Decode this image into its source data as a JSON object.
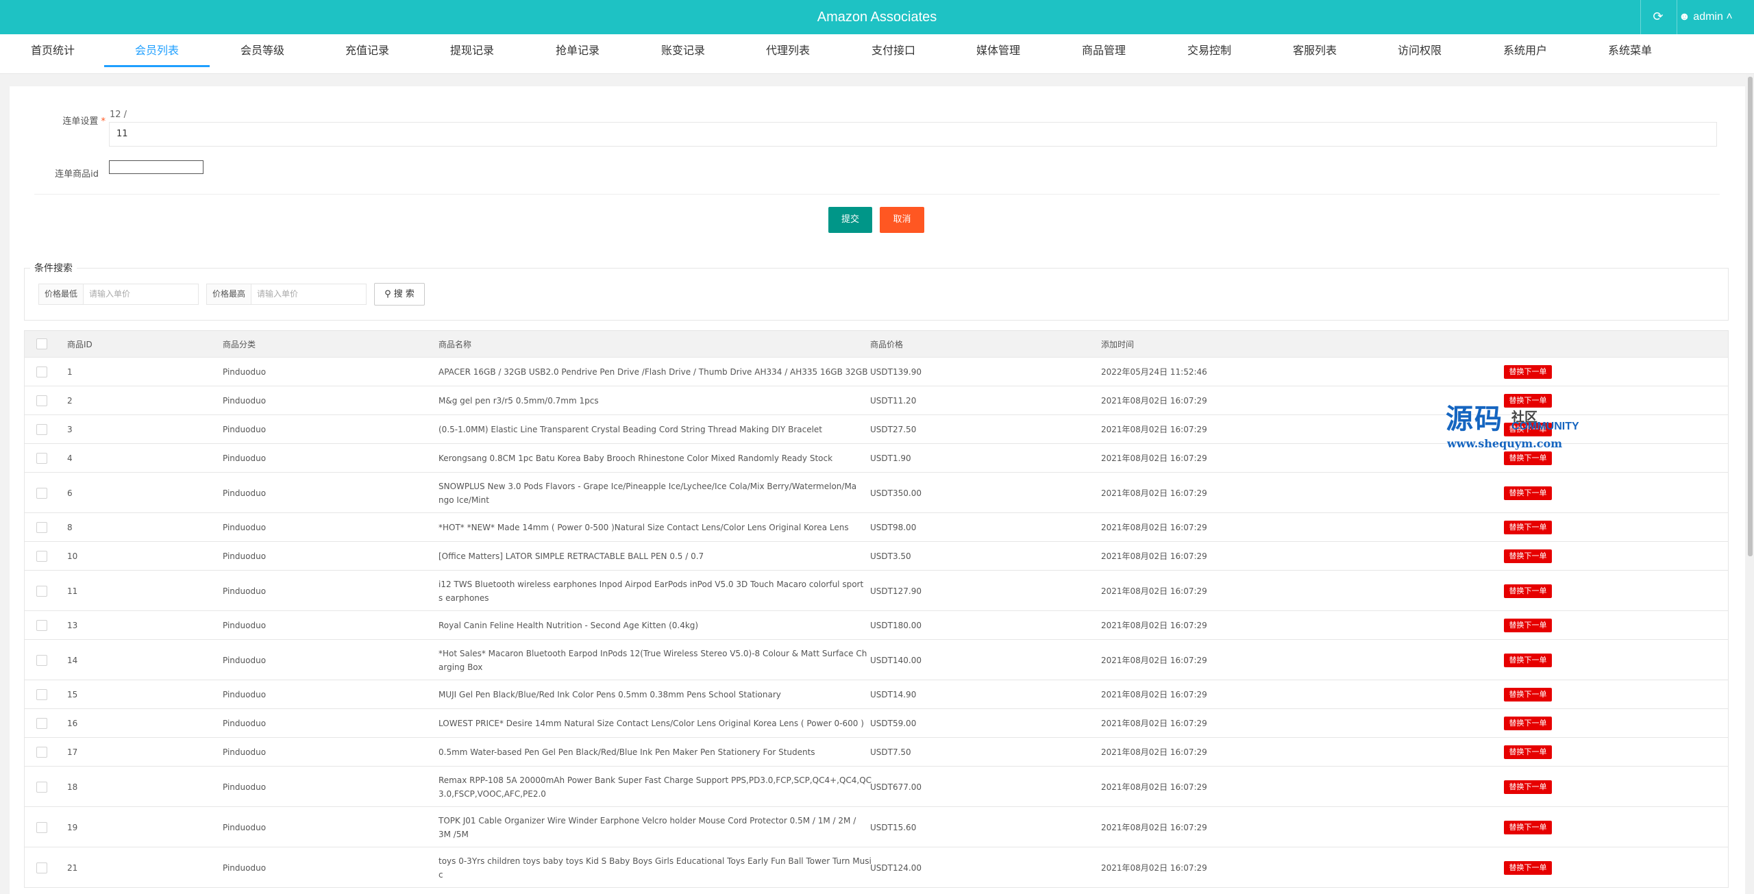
{
  "header": {
    "title": "Amazon Associates",
    "user": "admin",
    "refresh_icon": "refresh-icon",
    "user_icon": "user-icon"
  },
  "nav": {
    "tabs": [
      {
        "label": "首页统计",
        "active": false
      },
      {
        "label": "会员列表",
        "active": true
      },
      {
        "label": "会员等级",
        "active": false
      },
      {
        "label": "充值记录",
        "active": false
      },
      {
        "label": "提现记录",
        "active": false
      },
      {
        "label": "抢单记录",
        "active": false
      },
      {
        "label": "账变记录",
        "active": false
      },
      {
        "label": "代理列表",
        "active": false
      },
      {
        "label": "支付接口",
        "active": false
      },
      {
        "label": "媒体管理",
        "active": false
      },
      {
        "label": "商品管理",
        "active": false
      },
      {
        "label": "交易控制",
        "active": false
      },
      {
        "label": "客服列表",
        "active": false
      },
      {
        "label": "访问权限",
        "active": false
      },
      {
        "label": "系统用户",
        "active": false
      },
      {
        "label": "系统菜单",
        "active": false
      }
    ]
  },
  "form": {
    "order_setting_label": "连单设置",
    "required_mark": "*",
    "order_setting_hint": "12 /",
    "order_setting_value": "11",
    "product_id_label": "连单商品id",
    "product_id_value": "",
    "submit_label": "提交",
    "cancel_label": "取消"
  },
  "search": {
    "legend": "条件搜索",
    "min_price_label": "价格最低",
    "min_price_placeholder": "请输入单价",
    "max_price_label": "价格最高",
    "max_price_placeholder": "请输入单价",
    "search_label": "搜 索"
  },
  "table": {
    "headers": [
      "商品ID",
      "商品分类",
      "商品名称",
      "商品价格",
      "添加时间"
    ],
    "action_label": "替换下一单",
    "rows": [
      {
        "id": "1",
        "category": "Pinduoduo",
        "name_lines": [
          "APACER 16GB / 32GB USB2.0 Pendrive Pen Drive /Flash Drive / Thumb Drive AH334 / AH335 16GB 32GB"
        ],
        "price": "USDT139.90",
        "time": "2022年05月24日 11:52:46"
      },
      {
        "id": "2",
        "category": "Pinduoduo",
        "name_lines": [
          "M&g gel pen r3/r5 0.5mm/0.7mm 1pcs"
        ],
        "price": "USDT11.20",
        "time": "2021年08月02日 16:07:29"
      },
      {
        "id": "3",
        "category": "Pinduoduo",
        "name_lines": [
          "(0.5-1.0MM) Elastic Line Transparent Crystal Beading Cord String Thread Making DIY Bracelet"
        ],
        "price": "USDT27.50",
        "time": "2021年08月02日 16:07:29"
      },
      {
        "id": "4",
        "category": "Pinduoduo",
        "name_lines": [
          "Kerongsang 0.8CM 1pc Batu Korea Baby Brooch Rhinestone Color Mixed Randomly Ready Stock"
        ],
        "price": "USDT1.90",
        "time": "2021年08月02日 16:07:29"
      },
      {
        "id": "6",
        "category": "Pinduoduo",
        "name_lines": [
          "SNOWPLUS New 3.0 Pods Flavors - Grape Ice/Pineapple Ice/Lychee/Ice Cola/Mix Berry/Watermelon/Ma",
          "ngo Ice/Mint"
        ],
        "price": "USDT350.00",
        "time": "2021年08月02日 16:07:29"
      },
      {
        "id": "8",
        "category": "Pinduoduo",
        "name_lines": [
          "*HOT* *NEW* Made 14mm ( Power 0-500 )Natural Size Contact Lens/Color Lens Original Korea Lens"
        ],
        "price": "USDT98.00",
        "time": "2021年08月02日 16:07:29"
      },
      {
        "id": "10",
        "category": "Pinduoduo",
        "name_lines": [
          "[Office Matters] LATOR SIMPLE RETRACTABLE BALL PEN 0.5 / 0.7"
        ],
        "price": "USDT3.50",
        "time": "2021年08月02日 16:07:29"
      },
      {
        "id": "11",
        "category": "Pinduoduo",
        "name_lines": [
          "i12 TWS Bluetooth wireless earphones Inpod Airpod EarPods inPod V5.0 3D Touch Macaro colorful sport",
          "s earphones"
        ],
        "price": "USDT127.90",
        "time": "2021年08月02日 16:07:29"
      },
      {
        "id": "13",
        "category": "Pinduoduo",
        "name_lines": [
          "Royal Canin Feline Health Nutrition - Second Age Kitten (0.4kg)"
        ],
        "price": "USDT180.00",
        "time": "2021年08月02日 16:07:29"
      },
      {
        "id": "14",
        "category": "Pinduoduo",
        "name_lines": [
          "*Hot Sales* Macaron Bluetooth Earpod InPods 12(True Wireless Stereo V5.0)-8 Colour & Matt Surface Ch",
          "arging Box"
        ],
        "price": "USDT140.00",
        "time": "2021年08月02日 16:07:29"
      },
      {
        "id": "15",
        "category": "Pinduoduo",
        "name_lines": [
          "MUJI Gel Pen Black/Blue/Red Ink Color Pens 0.5mm 0.38mm Pens School Stationary"
        ],
        "price": "USDT14.90",
        "time": "2021年08月02日 16:07:29"
      },
      {
        "id": "16",
        "category": "Pinduoduo",
        "name_lines": [
          "LOWEST PRICE* Desire 14mm Natural Size Contact Lens/Color Lens Original Korea Lens ( Power 0-600 )"
        ],
        "price": "USDT59.00",
        "time": "2021年08月02日 16:07:29"
      },
      {
        "id": "17",
        "category": "Pinduoduo",
        "name_lines": [
          "0.5mm Water-based Pen Gel Pen Black/Red/Blue Ink Pen Maker Pen Stationery For Students"
        ],
        "price": "USDT7.50",
        "time": "2021年08月02日 16:07:29"
      },
      {
        "id": "18",
        "category": "Pinduoduo",
        "name_lines": [
          "Remax RPP-108 5A 20000mAh Power Bank Super Fast Charge Support PPS,PD3.0,FCP,SCP,QC4+,QC4,QC",
          "3.0,FSCP,VOOC,AFC,PE2.0"
        ],
        "price": "USDT677.00",
        "time": "2021年08月02日 16:07:29"
      },
      {
        "id": "19",
        "category": "Pinduoduo",
        "name_lines": [
          "TOPK J01 Cable Organizer Wire Winder Earphone Velcro holder Mouse Cord Protector 0.5M / 1M / 2M /",
          "3M /5M"
        ],
        "price": "USDT15.60",
        "time": "2021年08月02日 16:07:29"
      },
      {
        "id": "21",
        "category": "Pinduoduo",
        "name_lines": [
          "toys 0-3Yrs children toys baby toys Kid S Baby Boys Girls Educational Toys Early Fun Ball Tower Turn Musi",
          "c"
        ],
        "price": "USDT124.00",
        "time": "2021年08月02日 16:07:29"
      }
    ]
  },
  "watermark": {
    "big": "源码",
    "small": "社区",
    "community": "COMMUNITY",
    "url": "www.shequym.com"
  }
}
